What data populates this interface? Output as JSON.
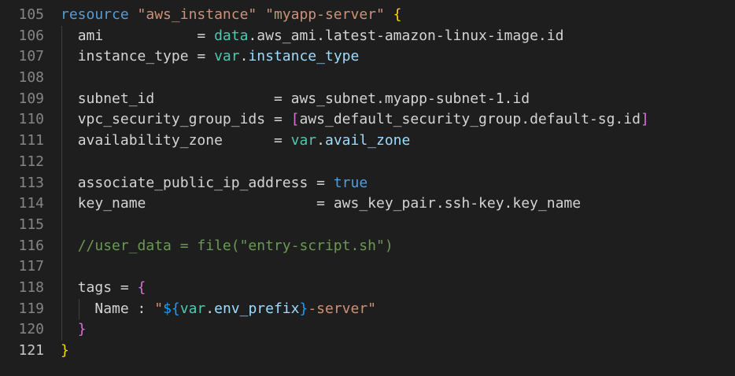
{
  "editor": {
    "active_line": 121,
    "colors": {
      "background": "#1e1e1e",
      "keyword": "#569cd6",
      "string": "#ce9178",
      "identifier": "#9cdcfe",
      "variable": "#4ec9b0",
      "bracket_gold": "#ffd700",
      "bracket_purple": "#da70d6",
      "bracket_blue": "#179fff",
      "comment": "#6a9955",
      "line_number": "#858585"
    },
    "lines": [
      {
        "n": "105",
        "indent": "",
        "tokens": [
          {
            "t": "resource",
            "c": "kw"
          },
          {
            "t": " ",
            "c": "txt"
          },
          {
            "t": "\"aws_instance\"",
            "c": "str"
          },
          {
            "t": " ",
            "c": "txt"
          },
          {
            "t": "\"myapp-server\"",
            "c": "str"
          },
          {
            "t": " ",
            "c": "txt"
          },
          {
            "t": "{",
            "c": "br1"
          }
        ]
      },
      {
        "n": "106",
        "indent": "  ",
        "tokens": [
          {
            "t": "ami           ",
            "c": "txt"
          },
          {
            "t": "= ",
            "c": "txt"
          },
          {
            "t": "data",
            "c": "var"
          },
          {
            "t": ".aws_ami.latest-amazon-linux-image.id",
            "c": "txt"
          }
        ]
      },
      {
        "n": "107",
        "indent": "  ",
        "tokens": [
          {
            "t": "instance_type ",
            "c": "txt"
          },
          {
            "t": "= ",
            "c": "txt"
          },
          {
            "t": "var",
            "c": "var"
          },
          {
            "t": ".",
            "c": "txt"
          },
          {
            "t": "instance_type",
            "c": "id"
          }
        ]
      },
      {
        "n": "108",
        "indent": "",
        "tokens": []
      },
      {
        "n": "109",
        "indent": "  ",
        "tokens": [
          {
            "t": "subnet_id              ",
            "c": "txt"
          },
          {
            "t": "= ",
            "c": "txt"
          },
          {
            "t": "aws_subnet.myapp-subnet-1.id",
            "c": "txt"
          }
        ]
      },
      {
        "n": "110",
        "indent": "  ",
        "tokens": [
          {
            "t": "vpc_security_group_ids ",
            "c": "txt"
          },
          {
            "t": "= ",
            "c": "txt"
          },
          {
            "t": "[",
            "c": "br2"
          },
          {
            "t": "aws_default_security_group.default-sg.id",
            "c": "txt"
          },
          {
            "t": "]",
            "c": "br2"
          }
        ]
      },
      {
        "n": "111",
        "indent": "  ",
        "tokens": [
          {
            "t": "availability_zone      ",
            "c": "txt"
          },
          {
            "t": "= ",
            "c": "txt"
          },
          {
            "t": "var",
            "c": "var"
          },
          {
            "t": ".",
            "c": "txt"
          },
          {
            "t": "avail_zone",
            "c": "id"
          }
        ]
      },
      {
        "n": "112",
        "indent": "",
        "tokens": []
      },
      {
        "n": "113",
        "indent": "  ",
        "tokens": [
          {
            "t": "associate_public_ip_address ",
            "c": "txt"
          },
          {
            "t": "= ",
            "c": "txt"
          },
          {
            "t": "true",
            "c": "kw"
          }
        ]
      },
      {
        "n": "114",
        "indent": "  ",
        "tokens": [
          {
            "t": "key_name                    ",
            "c": "txt"
          },
          {
            "t": "= ",
            "c": "txt"
          },
          {
            "t": "aws_key_pair.ssh-key.key_name",
            "c": "txt"
          }
        ]
      },
      {
        "n": "115",
        "indent": "",
        "tokens": []
      },
      {
        "n": "116",
        "indent": "  ",
        "tokens": [
          {
            "t": "//user_data = file(\"entry-script.sh\")",
            "c": "cmt"
          }
        ]
      },
      {
        "n": "117",
        "indent": "",
        "tokens": []
      },
      {
        "n": "118",
        "indent": "  ",
        "tokens": [
          {
            "t": "tags = ",
            "c": "txt"
          },
          {
            "t": "{",
            "c": "br2"
          }
        ]
      },
      {
        "n": "119",
        "indent": "    ",
        "tokens": [
          {
            "t": "Name : ",
            "c": "txt"
          },
          {
            "t": "\"",
            "c": "str"
          },
          {
            "t": "${",
            "c": "br3"
          },
          {
            "t": "var",
            "c": "var"
          },
          {
            "t": ".",
            "c": "txt"
          },
          {
            "t": "env_prefix",
            "c": "id"
          },
          {
            "t": "}",
            "c": "br3"
          },
          {
            "t": "-server\"",
            "c": "str"
          }
        ]
      },
      {
        "n": "120",
        "indent": "  ",
        "tokens": [
          {
            "t": "}",
            "c": "br2"
          }
        ]
      },
      {
        "n": "121",
        "indent": "",
        "tokens": [
          {
            "t": "}",
            "c": "br1"
          }
        ]
      }
    ]
  }
}
